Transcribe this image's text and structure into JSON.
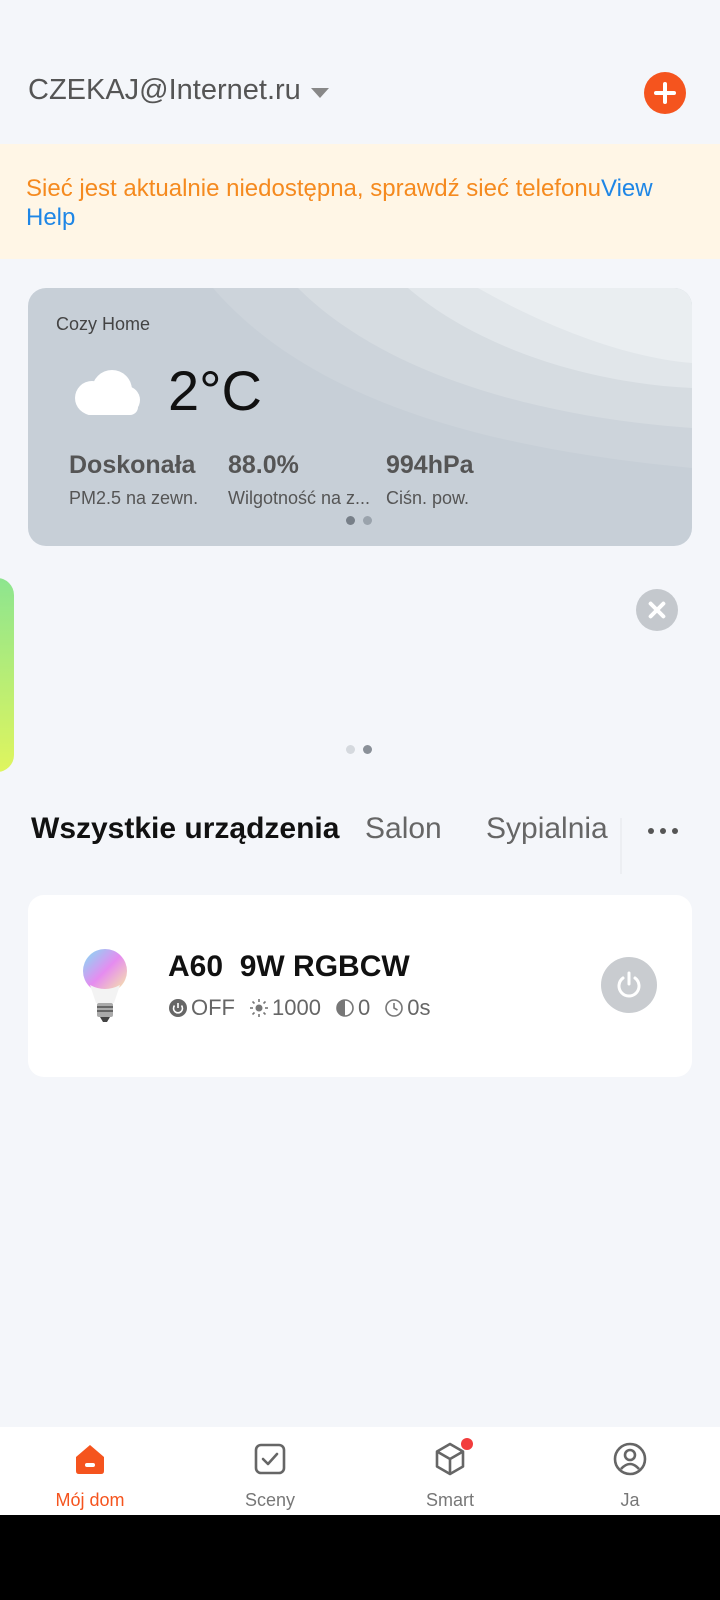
{
  "header": {
    "account": "CZEKAJ@Internet.ru"
  },
  "banner": {
    "warning": "Sieć jest aktualnie niedostępna, sprawdź sieć telefonu",
    "help_link": "View Help"
  },
  "weather": {
    "home_name": "Cozy Home",
    "icon": "cloud-icon",
    "temperature": "2°C",
    "stats": [
      {
        "value": "Doskonała",
        "label": "PM2.5 na zewn."
      },
      {
        "value": "88.0%",
        "label": "Wilgotność na z..."
      },
      {
        "value": "994hPa",
        "label": "Ciśn. pow."
      }
    ],
    "page_indicator": {
      "current": 1,
      "total": 2
    }
  },
  "carousel": {
    "page_indicator": {
      "current": 2,
      "total": 2
    }
  },
  "tabs": [
    {
      "label": "Wszystkie urządzenia",
      "active": true
    },
    {
      "label": "Salon",
      "active": false
    },
    {
      "label": "Sypialnia",
      "active": false
    }
  ],
  "device": {
    "name": "A60  9W RGBCW",
    "power_state": "OFF",
    "brightness": "1000",
    "contrast": "0",
    "timer": "0s"
  },
  "nav": [
    {
      "label": "Mój dom",
      "icon": "home-icon",
      "active": true
    },
    {
      "label": "Sceny",
      "icon": "scenes-icon",
      "active": false
    },
    {
      "label": "Smart",
      "icon": "smart-icon",
      "active": false,
      "badge": true
    },
    {
      "label": "Ja",
      "icon": "profile-icon",
      "active": false
    }
  ],
  "colors": {
    "accent": "#f5541e",
    "warning": "#f58a1f",
    "link": "#1e86e6"
  }
}
